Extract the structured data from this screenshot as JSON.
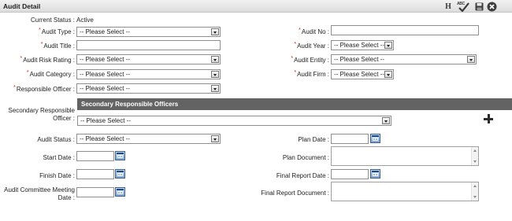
{
  "window": {
    "title": "Audit Detail"
  },
  "toolbar": {
    "history_label": "H",
    "spellcheck_label": "ABC",
    "save_icon": "save-icon",
    "close_icon": "close-icon"
  },
  "status": {
    "label": "Current Status :",
    "value": "Active"
  },
  "fields": {
    "audit_type": {
      "label": "Audit Type :",
      "value": "-- Please Select --",
      "required": true
    },
    "audit_title": {
      "label": "Audit Title :",
      "value": "",
      "required": true
    },
    "audit_risk_rating": {
      "label": "Audit Risk Rating :",
      "value": "-- Please Select --",
      "required": true
    },
    "audit_category": {
      "label": "Audit Category :",
      "value": "-- Please Select --",
      "required": true
    },
    "responsible_officer": {
      "label": "Responsible Officer :",
      "value": "-- Please Select --",
      "required": true
    },
    "audit_no": {
      "label": "Audit No :",
      "value": "",
      "required": true
    },
    "audit_year": {
      "label": "Audit Year :",
      "value": "-- Please Select --",
      "required": true
    },
    "audit_entity": {
      "label": "Audit Entity :",
      "value": "-- Please Select --",
      "required": true
    },
    "audit_firm": {
      "label": "Audit Firm :",
      "value": "-- Please Select --",
      "required": true
    },
    "secondary_responsible_officer": {
      "label_line1": "Secondary Responsible",
      "label_line2": "Officer :",
      "value": "-- Please Select --"
    },
    "audit_status": {
      "label": "Audit Status :",
      "value": "-- Please Select --"
    },
    "start_date": {
      "label": "Start Date :",
      "value": ""
    },
    "finish_date": {
      "label": "Finish Date :",
      "value": ""
    },
    "audit_committee_meeting_date": {
      "label_line1": "Audit Committee Meeting",
      "label_line2": "Date :",
      "value": ""
    },
    "plan_date": {
      "label": "Plan Date :",
      "value": ""
    },
    "plan_document": {
      "label": "Plan Document :",
      "value": ""
    },
    "final_report_date": {
      "label": "Final Report Date :",
      "value": ""
    },
    "final_report_document": {
      "label": "Final Report Document :",
      "value": ""
    }
  },
  "secondary_section": {
    "header": "Secondary Responsible Officers",
    "add_icon": "plus-icon"
  },
  "colors": {
    "section_header_bg": "#636363",
    "required_marker": "#dd1111",
    "calendar_icon": "#7ea3cf"
  }
}
